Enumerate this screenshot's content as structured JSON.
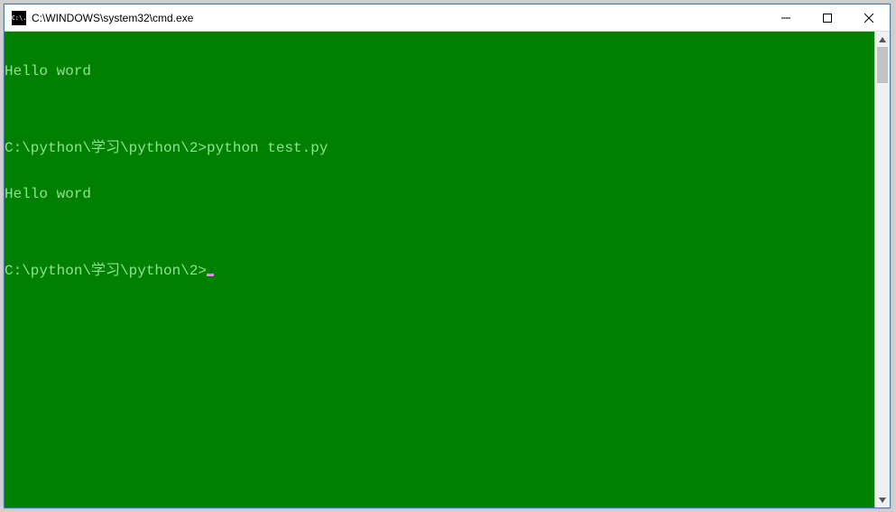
{
  "titlebar": {
    "icon_glyph": "C:\\.",
    "title": "C:\\WINDOWS\\system32\\cmd.exe"
  },
  "terminal": {
    "lines": [
      "Hello word",
      "",
      "C:\\python\\学习\\python\\2>python test.py",
      "Hello word",
      "",
      "C:\\python\\学习\\python\\2>"
    ]
  },
  "colors": {
    "terminal_bg": "#008000",
    "terminal_fg": "#8fe38f",
    "cursor": "#ff7fff"
  }
}
